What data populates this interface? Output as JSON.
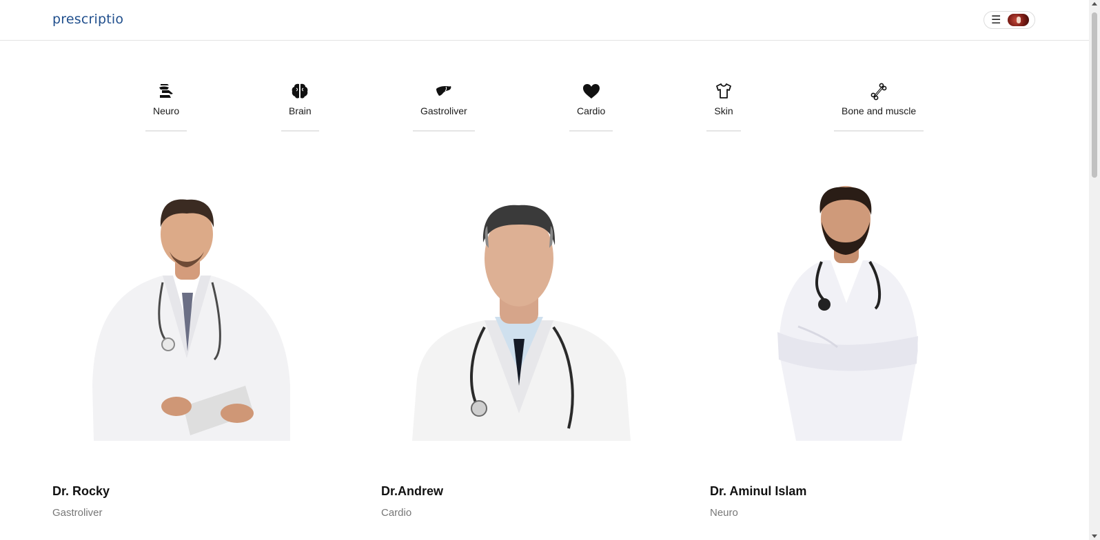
{
  "header": {
    "logo_text": "prescriptio",
    "menu_icon": "☰",
    "avatar_icon": "user-avatar"
  },
  "categories": [
    {
      "label": "Neuro",
      "icon": "neuro-icon"
    },
    {
      "label": "Brain",
      "icon": "brain-icon"
    },
    {
      "label": "Gastroliver",
      "icon": "liver-icon"
    },
    {
      "label": "Cardio",
      "icon": "heart-icon"
    },
    {
      "label": "Skin",
      "icon": "shirt-icon"
    },
    {
      "label": "Bone and muscle",
      "icon": "bone-icon"
    }
  ],
  "doctors": [
    {
      "name": "Dr. Rocky",
      "speciality": "Gastroliver"
    },
    {
      "name": "Dr.Andrew",
      "speciality": "Cardio"
    },
    {
      "name": "Dr. Aminul Islam",
      "speciality": "Neuro"
    }
  ],
  "colors": {
    "brand": "#1f4e8c",
    "text": "#111111",
    "muted": "#777777",
    "divider": "#e5e5e5"
  }
}
